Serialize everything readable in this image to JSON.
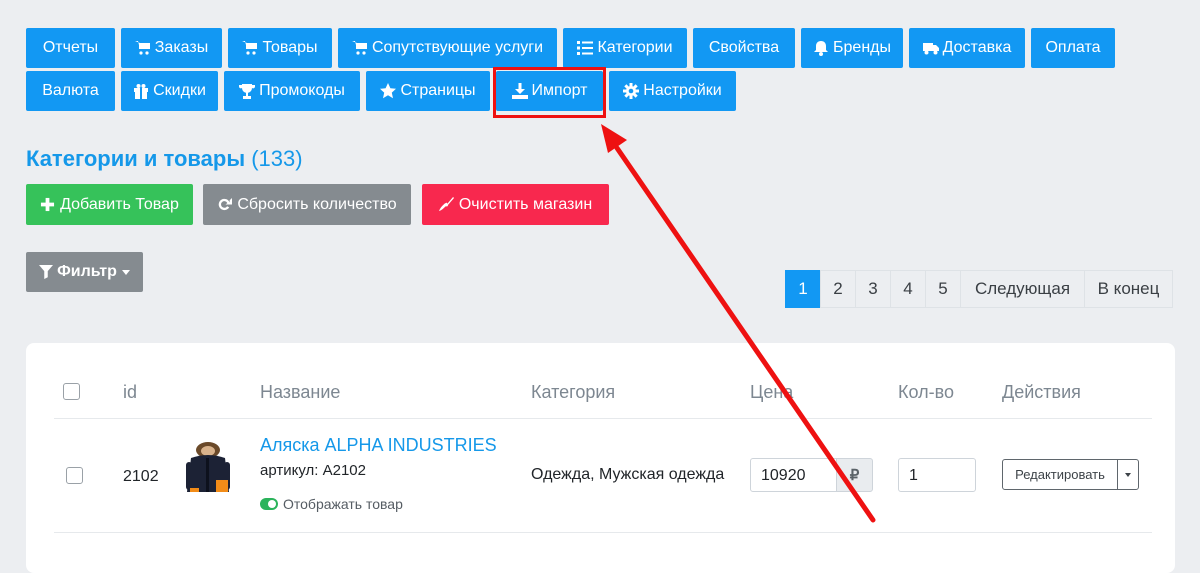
{
  "nav": {
    "row1": [
      {
        "label": "Отчеты",
        "icon": ""
      },
      {
        "label": "Заказы",
        "icon": "cart-icon"
      },
      {
        "label": "Товары",
        "icon": "cart-icon"
      },
      {
        "label": "Сопутствующие услуги",
        "icon": "cart-icon"
      },
      {
        "label": "Категории",
        "icon": "list-icon"
      },
      {
        "label": "Свойства",
        "icon": ""
      },
      {
        "label": "Бренды",
        "icon": "bell-icon"
      },
      {
        "label": "Доставка",
        "icon": "truck-icon"
      },
      {
        "label": "Оплата",
        "icon": ""
      }
    ],
    "row2": [
      {
        "label": "Валюта",
        "icon": ""
      },
      {
        "label": "Скидки",
        "icon": "gift-icon"
      },
      {
        "label": "Промокоды",
        "icon": "trophy-icon"
      },
      {
        "label": "Страницы",
        "icon": "star-icon"
      },
      {
        "label": "Импорт",
        "icon": "download-icon"
      },
      {
        "label": "Настройки",
        "icon": "gear-icon"
      }
    ]
  },
  "page": {
    "title": "Категории и товары",
    "count": "(133)"
  },
  "actions": {
    "add": "Добавить Товар",
    "reset": "Сбросить количество",
    "clear": "Очистить магазин"
  },
  "filter": {
    "label": "Фильтр"
  },
  "pagination": {
    "pages": [
      "1",
      "2",
      "3",
      "4",
      "5"
    ],
    "next": "Следующая",
    "last": "В конец",
    "active": "1"
  },
  "table": {
    "headers": {
      "id": "id",
      "name": "Название",
      "category": "Категория",
      "price": "Цена",
      "qty": "Кол-во",
      "actions": "Действия"
    },
    "rows": [
      {
        "id": "2102",
        "name": "Аляска ALPHA INDUSTRIES",
        "sku": "артикул: A2102",
        "visibility": "Отображать товар",
        "category": "Одежда, Мужская одежда",
        "price": "10920",
        "currency": "₽",
        "qty": "1",
        "edit": "Редактировать"
      }
    ]
  },
  "colors": {
    "primary": "#1298f3",
    "success": "#36c25a",
    "secondary": "#858b90",
    "danger": "#f8284e",
    "highlight": "#ee1111",
    "link": "#1598e9"
  }
}
